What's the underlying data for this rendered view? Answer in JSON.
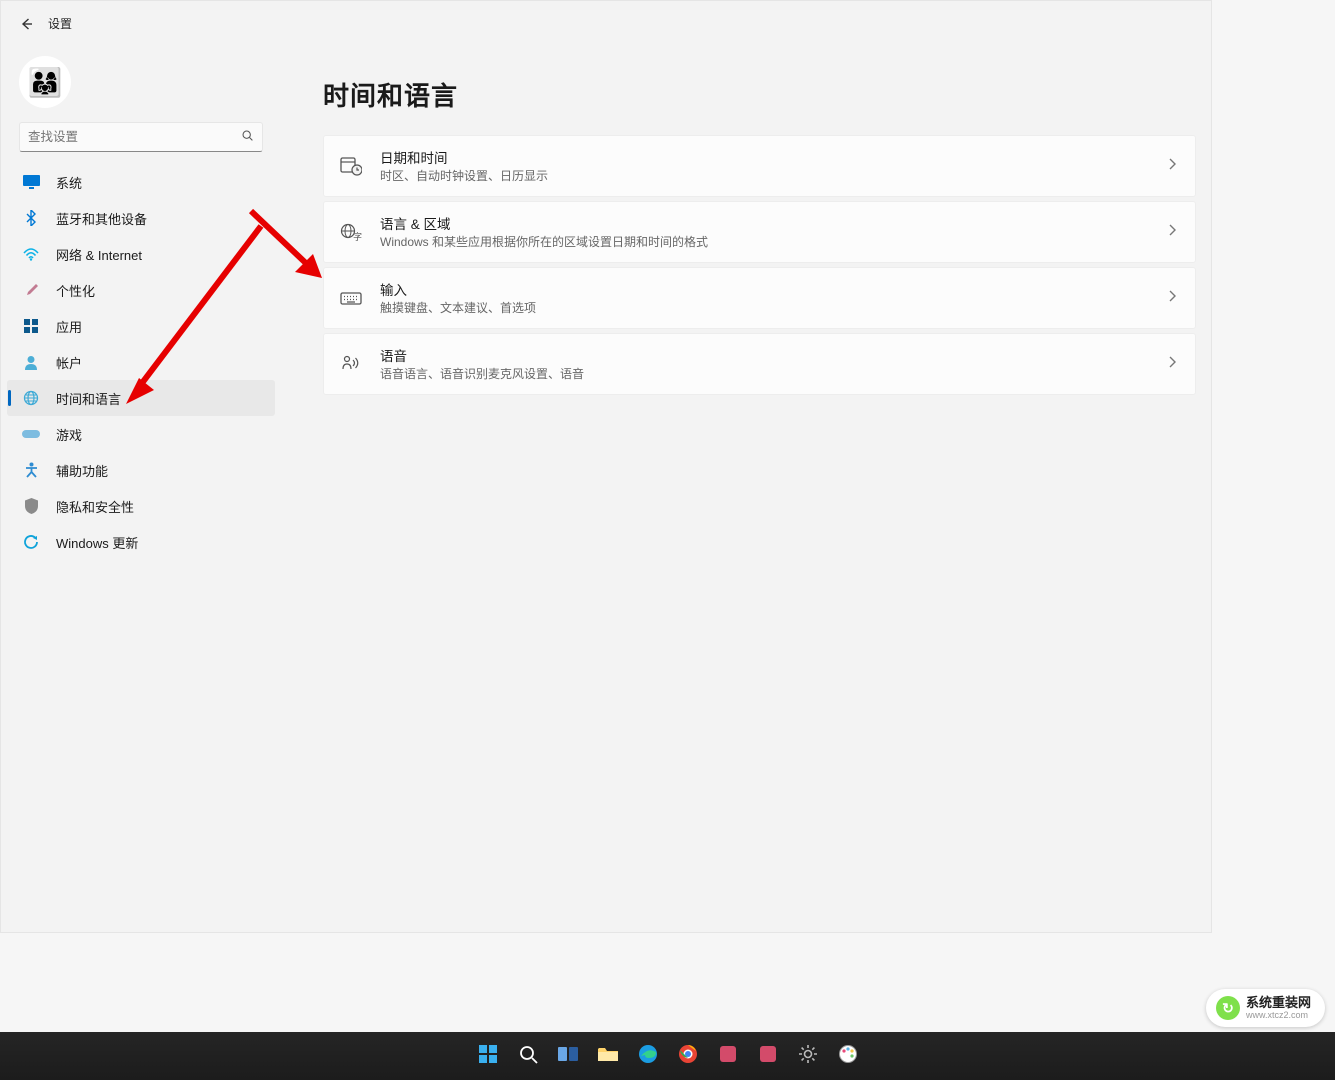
{
  "header": {
    "title": "设置"
  },
  "search": {
    "placeholder": "查找设置"
  },
  "nav": [
    {
      "id": "system",
      "label": "系统",
      "icon": "display-icon",
      "color": "#0078d4"
    },
    {
      "id": "bluetooth",
      "label": "蓝牙和其他设备",
      "icon": "bluetooth-icon",
      "color": "#0078d4"
    },
    {
      "id": "network",
      "label": "网络 & Internet",
      "icon": "network-icon",
      "color": "#0cb2e7"
    },
    {
      "id": "personalize",
      "label": "个性化",
      "icon": "brush-icon",
      "color": "#c27b92"
    },
    {
      "id": "apps",
      "label": "应用",
      "icon": "apps-icon",
      "color": "#0d598c"
    },
    {
      "id": "accounts",
      "label": "帐户",
      "icon": "person-icon",
      "color": "#4caed6"
    },
    {
      "id": "time-language",
      "label": "时间和语言",
      "icon": "globe-icon",
      "color": "#3eaad6",
      "active": true
    },
    {
      "id": "gaming",
      "label": "游戏",
      "icon": "gaming-icon",
      "color": "#7dbce0"
    },
    {
      "id": "accessibility",
      "label": "辅助功能",
      "icon": "accessibility-icon",
      "color": "#2e8cd1"
    },
    {
      "id": "privacy",
      "label": "隐私和安全性",
      "icon": "shield-icon",
      "color": "#8a8a8a"
    },
    {
      "id": "update",
      "label": "Windows 更新",
      "icon": "update-icon",
      "color": "#0fa3da"
    }
  ],
  "page": {
    "title": "时间和语言",
    "items": [
      {
        "id": "date-time",
        "title": "日期和时间",
        "subtitle": "时区、自动时钟设置、日历显示",
        "icon": "clock-calendar-icon"
      },
      {
        "id": "language-region",
        "title": "语言 & 区域",
        "subtitle": "Windows 和某些应用根据你所在的区域设置日期和时间的格式",
        "icon": "globe-lang-icon"
      },
      {
        "id": "typing",
        "title": "输入",
        "subtitle": "触摸键盘、文本建议、首选项",
        "icon": "keyboard-icon"
      },
      {
        "id": "speech",
        "title": "语音",
        "subtitle": "语音语言、语音识别麦克风设置、语音",
        "icon": "speech-icon"
      }
    ]
  },
  "taskbar": [
    {
      "id": "start",
      "name": "start-icon"
    },
    {
      "id": "search",
      "name": "search-task-icon"
    },
    {
      "id": "taskview",
      "name": "taskview-icon"
    },
    {
      "id": "explorer",
      "name": "explorer-icon"
    },
    {
      "id": "edge",
      "name": "edge-icon"
    },
    {
      "id": "chrome",
      "name": "chrome-icon"
    },
    {
      "id": "app7",
      "name": "app-icon"
    },
    {
      "id": "app8",
      "name": "app-icon"
    },
    {
      "id": "settings",
      "name": "settings-task-icon"
    },
    {
      "id": "paint",
      "name": "paint-icon"
    }
  ],
  "watermark": {
    "title": "系统重装网",
    "sub": "www.xtcz2.com"
  }
}
